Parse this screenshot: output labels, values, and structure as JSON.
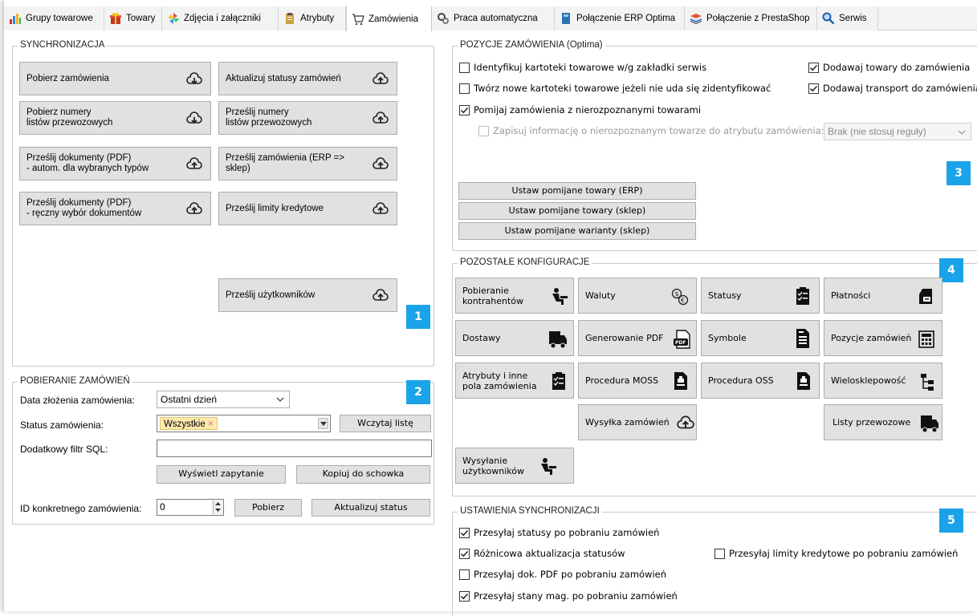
{
  "tabs": [
    {
      "label": "Grupy towarowe",
      "icon": "bar-chart-icon"
    },
    {
      "label": "Towary",
      "icon": "gift-icon"
    },
    {
      "label": "Zdjęcia i załączniki",
      "icon": "pinwheel-icon"
    },
    {
      "label": "Atrybuty",
      "icon": "clipboard-icon"
    },
    {
      "label": "Zamówienia",
      "icon": "cart-icon",
      "active": true
    },
    {
      "label": "Praca automatyczna",
      "icon": "gears-icon"
    },
    {
      "label": "Połączenie ERP Optima",
      "icon": "book-icon"
    },
    {
      "label": "Połączenie z PrestaShop",
      "icon": "stack-icon"
    },
    {
      "label": "Serwis",
      "icon": "magnifier-icon"
    }
  ],
  "sync": {
    "title": "SYNCHRONIZACJA",
    "buttons": [
      {
        "label": "Pobierz zamówienia",
        "icon": "cloud-download-icon"
      },
      {
        "label": "Aktualizuj statusy zamówień",
        "icon": "cloud-upload-icon"
      },
      {
        "label1": "Pobierz numery",
        "label2": "listów przewozowych",
        "icon": "cloud-download-icon"
      },
      {
        "label1": "Prześlij numery",
        "label2": "listów przewozowych",
        "icon": "cloud-upload-icon"
      },
      {
        "label1": "Prześlij dokumenty (PDF)",
        "label2": "- autom. dla wybranych typów",
        "icon": "cloud-upload-icon"
      },
      {
        "label1": "Prześlij zamówienia (ERP =>",
        "label2": "sklep)",
        "icon": "cloud-upload-icon"
      },
      {
        "label1": "Prześlij dokumenty (PDF)",
        "label2": "- ręczny wybór dokumentów",
        "icon": "cloud-upload-icon"
      },
      {
        "label": "Prześlij limity kredytowe",
        "icon": "cloud-upload-icon"
      },
      {
        "label": "Prześlij użytkowników",
        "icon": "cloud-upload-icon"
      }
    ],
    "badge": "1"
  },
  "fetch": {
    "title": "POBIERANIE ZAMÓWIEŃ",
    "badge": "2",
    "date_label": "Data złożenia zamówienia:",
    "date_value": "Ostatni dzień",
    "status_label": "Status zamówienia:",
    "status_tag": "Wszystkie",
    "load_list": "Wczytaj listę",
    "sql_label": "Dodatkowy filtr SQL:",
    "sql_value": "",
    "show_query": "Wyświetl zapytanie",
    "copy_clipboard": "Kopiuj do schowka",
    "id_label": "ID konkretnego zamówienia:",
    "id_value": "0",
    "fetch_btn": "Pobierz",
    "update_status_btn": "Aktualizuj status"
  },
  "positions": {
    "title": "POZYCJE ZAMÓWIENIA (Optima)",
    "badge": "3",
    "checks": [
      {
        "label": "Identyfikuj kartoteki towarowe w/g zakładki serwis",
        "checked": false
      },
      {
        "label": "Dodawaj towary do zamówienia",
        "checked": true
      },
      {
        "label": "Twórz nowe kartoteki towarowe jeżeli nie uda się zidentyfikować",
        "checked": false
      },
      {
        "label": "Dodawaj transport do zamówienia",
        "checked": true
      },
      {
        "label": "Pomijaj zamówienia z nierozpoznanymi towarami",
        "checked": true
      },
      {
        "label": "Zapisuj informację o nierozpoznanym towarze do atrybutu zamówienia:",
        "checked": false,
        "disabled": true
      }
    ],
    "rule_select": "Brak (nie stosuj reguły)",
    "btn1": "Ustaw pomijane towary (ERP)",
    "btn2": "Ustaw pomijane towary (sklep)",
    "btn3": "Ustaw pomijane warianty (sklep)"
  },
  "other": {
    "title": "POZOSTAŁE KONFIGURACJE",
    "badge": "4",
    "buttons": [
      {
        "label1": "Pobieranie",
        "label2": "kontrahentów",
        "icon": "person-desk-icon"
      },
      {
        "label": "Waluty",
        "icon": "currency-exchange-icon"
      },
      {
        "label": "Statusy",
        "icon": "checklist-icon"
      },
      {
        "label": "Płatności",
        "icon": "card-reader-icon"
      },
      {
        "label": "Dostawy",
        "icon": "truck-icon"
      },
      {
        "label": "Generowanie PDF",
        "icon": "pdf-icon"
      },
      {
        "label": "Symbole",
        "icon": "document-list-icon"
      },
      {
        "label": "Pozycje zamówień",
        "icon": "calculator-icon"
      },
      {
        "label1": "Atrybuty i inne",
        "label2": "pola zamówienia",
        "icon": "checklist-icon"
      },
      {
        "label": "Procedura MOSS",
        "icon": "document-stamp-icon"
      },
      {
        "label": "Procedura OSS",
        "icon": "document-stamp-icon"
      },
      {
        "label": "Wielosklepowość",
        "icon": "tree-icon"
      },
      {
        "label": "Wysyłka zamówień",
        "icon": "cloud-upload-icon"
      },
      {
        "label": "Listy przewozowe",
        "icon": "truck-icon"
      },
      {
        "label1": "Wysyłanie",
        "label2": "użytkowników",
        "icon": "person-desk-icon"
      }
    ]
  },
  "settings": {
    "title": "USTAWIENIA SYNCHRONIZACJI",
    "badge": "5",
    "checks": [
      {
        "label": "Przesyłaj statusy po pobraniu zamówień",
        "checked": true
      },
      {
        "label": "Różnicowa aktualizacja statusów",
        "checked": true
      },
      {
        "label": "Przesyłaj limity kredytowe po pobraniu zamówień",
        "checked": false
      },
      {
        "label": "Przesyłaj dok. PDF po pobraniu zamówień",
        "checked": false
      },
      {
        "label": "Przesyłaj stany mag. po pobraniu zamówień",
        "checked": true
      }
    ]
  }
}
